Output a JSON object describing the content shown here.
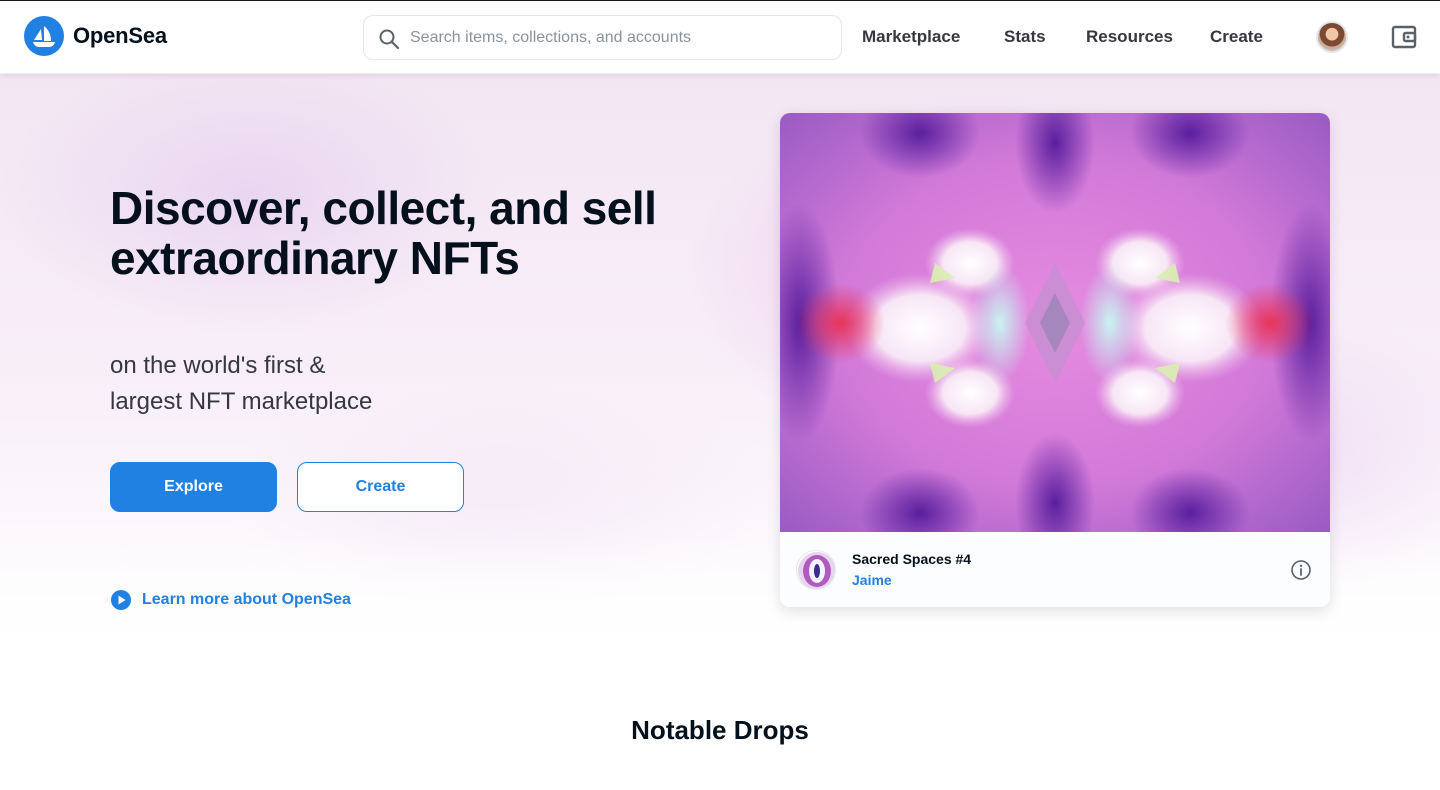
{
  "header": {
    "brand": "OpenSea",
    "search_placeholder": "Search items, collections, and accounts",
    "nav": {
      "marketplace": "Marketplace",
      "stats": "Stats",
      "resources": "Resources",
      "create": "Create"
    },
    "icons": [
      "opensea-logo-icon",
      "search-icon",
      "profile-avatar",
      "wallet-icon"
    ]
  },
  "hero": {
    "title": "Discover, collect, and sell extraordinary NFTs",
    "subtitle_line1": "on the world's first &",
    "subtitle_line2": "largest NFT marketplace",
    "explore_label": "Explore",
    "create_label": "Create",
    "learn_more": "Learn more about OpenSea"
  },
  "featured_card": {
    "title": "Sacred Spaces #4",
    "creator": "Jaime",
    "icons": [
      "info-icon"
    ]
  },
  "sections": {
    "notable_drops": "Notable Drops"
  },
  "colors": {
    "accent": "#2081e2",
    "text_dark": "#04111d",
    "text_muted": "#353840"
  }
}
